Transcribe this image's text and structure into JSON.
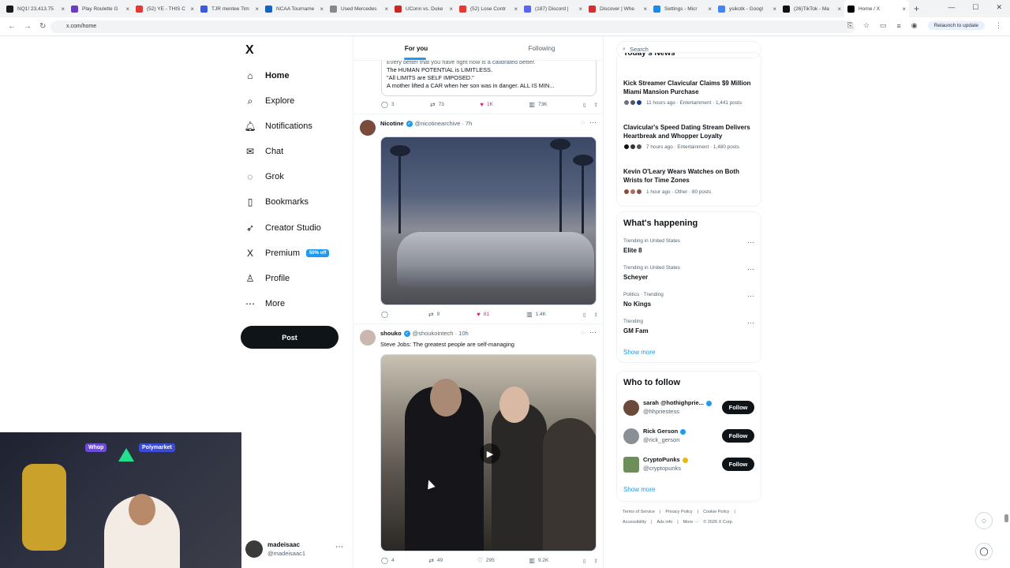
{
  "browser": {
    "tabs": [
      {
        "label": "NQ1! 23,413.75",
        "color": "#1a1a1a"
      },
      {
        "label": "Play Roulette G",
        "color": "#6a3fbf"
      },
      {
        "label": "(52) YE - THIS C",
        "color": "#e53935"
      },
      {
        "label": "TJR mentee Tim",
        "color": "#3b5bdb"
      },
      {
        "label": "NCAA Tourname",
        "color": "#1565c0"
      },
      {
        "label": "Used Mercedes",
        "color": "#888888"
      },
      {
        "label": "UConn vs. Duke",
        "color": "#c62828"
      },
      {
        "label": "(52) Lose Contr",
        "color": "#e53935"
      },
      {
        "label": "(187) Discord |",
        "color": "#5865f2"
      },
      {
        "label": "Discover | Whe",
        "color": "#d32f2f"
      },
      {
        "label": "Settings - Micr",
        "color": "#1e88e5"
      },
      {
        "label": "ysikotk - Googl",
        "color": "#4285f4"
      },
      {
        "label": "(26)TikTok - Ma",
        "color": "#111111"
      },
      {
        "label": "Home / X",
        "color": "#000000"
      }
    ],
    "new_tab": "+",
    "url": "x.com/home",
    "relaunch": "Relaunch to update"
  },
  "nav": {
    "logo": "X",
    "items": [
      {
        "label": "Home",
        "icon": "⌂",
        "name": "home"
      },
      {
        "label": "Explore",
        "icon": "⌕",
        "name": "explore"
      },
      {
        "label": "Notifications",
        "icon": "🔔︎",
        "name": "notifications"
      },
      {
        "label": "Chat",
        "icon": "✉",
        "name": "chat"
      },
      {
        "label": "Grok",
        "icon": "◌",
        "name": "grok"
      },
      {
        "label": "Bookmarks",
        "icon": "▯",
        "name": "bookmarks"
      },
      {
        "label": "Creator Studio",
        "icon": "➶",
        "name": "creator-studio"
      },
      {
        "label": "Premium",
        "icon": "X",
        "name": "premium"
      },
      {
        "label": "Profile",
        "icon": "♙",
        "name": "profile"
      },
      {
        "label": "More",
        "icon": "⋯",
        "name": "more"
      }
    ],
    "premium_badge": "50% off",
    "post": "Post",
    "account": {
      "name": "madeisaac",
      "handle": "@madeisaac1",
      "more": "⋯"
    }
  },
  "feed": {
    "tabs": [
      "For you",
      "Following"
    ],
    "quoted_text": [
      "Every better that you have right now is a calibrated better.",
      "The HUMAN POTENTIAL is LIMITLESS.",
      "\"All LIMITS are SELF IMPOSED.\"",
      "A mother lifted a CAR when her son was in danger. ALL IS MIN..."
    ],
    "tweets": [
      {
        "replies": "3",
        "reposts": "73",
        "likes": "1K",
        "views": "73K"
      },
      {
        "name": "Nicotine",
        "handle": "@nicotinearchive · 7h",
        "text": "",
        "replies": "",
        "reposts": "9",
        "likes": "81",
        "views": "1.4K"
      },
      {
        "name": "shouko",
        "handle": "@shoukointech · 10h",
        "text": "Steve Jobs: The greatest people are self-managing",
        "replies": "4",
        "reposts": "49",
        "likes": "295",
        "views": "9.2K"
      }
    ]
  },
  "sidebar": {
    "search_placeholder": "Search",
    "news_header": "Today's News",
    "news": [
      {
        "title": "Kick Streamer Clavicular Claims $9 Million Miami Mansion Purchase",
        "meta": "11 hours ago · Entertainment · 1,441 posts"
      },
      {
        "title": "Clavicular's Speed Dating Stream Delivers Heartbreak and Whopper Loyalty",
        "meta": "7 hours ago · Entertainment · 1,480 posts"
      },
      {
        "title": "Kevin O'Leary Wears Watches on Both Wrists for Time Zones",
        "meta": "1 hour ago · Other · 80 posts"
      }
    ],
    "happening_title": "What's happening",
    "trends": [
      {
        "context": "Trending in United States",
        "name": "Elite 8"
      },
      {
        "context": "Trending in United States",
        "name": "Scheyer"
      },
      {
        "context": "Politics · Trending",
        "name": "No Kings"
      },
      {
        "context": "Trending",
        "name": "GM Fam"
      }
    ],
    "show_more": "Show more",
    "who_title": "Who to follow",
    "follow": [
      {
        "name": "sarah @hothighprie...",
        "handle": "@hhpriestess",
        "badge": "blue",
        "avatar_color": "#6b4a3a"
      },
      {
        "name": "Rick Gerson",
        "handle": "@rick_gerson",
        "badge": "blue",
        "avatar_color": "#8a8f96"
      },
      {
        "name": "CryptoPunks",
        "handle": "@cryptopunks",
        "badge": "gold",
        "avatar_color": "#6c8f5a"
      }
    ],
    "follow_label": "Follow",
    "footer_line1": [
      "Terms of Service",
      "|",
      "Privacy Policy",
      "|",
      "Cookie Policy",
      "|"
    ],
    "footer_line2": [
      "Accessibility",
      "|",
      "Ads info",
      "|",
      "More ···",
      "© 2026 X Corp."
    ]
  },
  "webcam": {
    "light1": "Whop",
    "light2": "Polymarket"
  }
}
